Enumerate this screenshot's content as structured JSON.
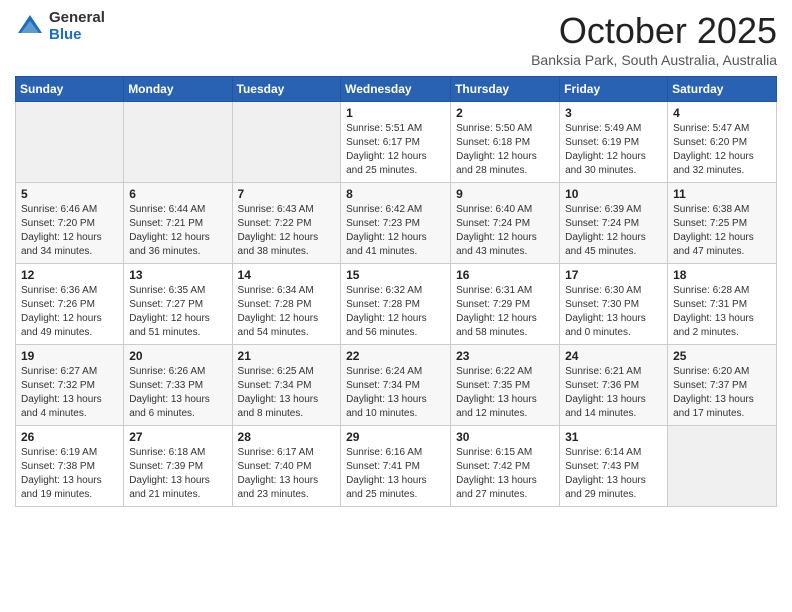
{
  "logo": {
    "general": "General",
    "blue": "Blue"
  },
  "header": {
    "month": "October 2025",
    "location": "Banksia Park, South Australia, Australia"
  },
  "days_of_week": [
    "Sunday",
    "Monday",
    "Tuesday",
    "Wednesday",
    "Thursday",
    "Friday",
    "Saturday"
  ],
  "weeks": [
    [
      {
        "day": "",
        "info": ""
      },
      {
        "day": "",
        "info": ""
      },
      {
        "day": "",
        "info": ""
      },
      {
        "day": "1",
        "info": "Sunrise: 5:51 AM\nSunset: 6:17 PM\nDaylight: 12 hours\nand 25 minutes."
      },
      {
        "day": "2",
        "info": "Sunrise: 5:50 AM\nSunset: 6:18 PM\nDaylight: 12 hours\nand 28 minutes."
      },
      {
        "day": "3",
        "info": "Sunrise: 5:49 AM\nSunset: 6:19 PM\nDaylight: 12 hours\nand 30 minutes."
      },
      {
        "day": "4",
        "info": "Sunrise: 5:47 AM\nSunset: 6:20 PM\nDaylight: 12 hours\nand 32 minutes."
      }
    ],
    [
      {
        "day": "5",
        "info": "Sunrise: 6:46 AM\nSunset: 7:20 PM\nDaylight: 12 hours\nand 34 minutes."
      },
      {
        "day": "6",
        "info": "Sunrise: 6:44 AM\nSunset: 7:21 PM\nDaylight: 12 hours\nand 36 minutes."
      },
      {
        "day": "7",
        "info": "Sunrise: 6:43 AM\nSunset: 7:22 PM\nDaylight: 12 hours\nand 38 minutes."
      },
      {
        "day": "8",
        "info": "Sunrise: 6:42 AM\nSunset: 7:23 PM\nDaylight: 12 hours\nand 41 minutes."
      },
      {
        "day": "9",
        "info": "Sunrise: 6:40 AM\nSunset: 7:24 PM\nDaylight: 12 hours\nand 43 minutes."
      },
      {
        "day": "10",
        "info": "Sunrise: 6:39 AM\nSunset: 7:24 PM\nDaylight: 12 hours\nand 45 minutes."
      },
      {
        "day": "11",
        "info": "Sunrise: 6:38 AM\nSunset: 7:25 PM\nDaylight: 12 hours\nand 47 minutes."
      }
    ],
    [
      {
        "day": "12",
        "info": "Sunrise: 6:36 AM\nSunset: 7:26 PM\nDaylight: 12 hours\nand 49 minutes."
      },
      {
        "day": "13",
        "info": "Sunrise: 6:35 AM\nSunset: 7:27 PM\nDaylight: 12 hours\nand 51 minutes."
      },
      {
        "day": "14",
        "info": "Sunrise: 6:34 AM\nSunset: 7:28 PM\nDaylight: 12 hours\nand 54 minutes."
      },
      {
        "day": "15",
        "info": "Sunrise: 6:32 AM\nSunset: 7:28 PM\nDaylight: 12 hours\nand 56 minutes."
      },
      {
        "day": "16",
        "info": "Sunrise: 6:31 AM\nSunset: 7:29 PM\nDaylight: 12 hours\nand 58 minutes."
      },
      {
        "day": "17",
        "info": "Sunrise: 6:30 AM\nSunset: 7:30 PM\nDaylight: 13 hours\nand 0 minutes."
      },
      {
        "day": "18",
        "info": "Sunrise: 6:28 AM\nSunset: 7:31 PM\nDaylight: 13 hours\nand 2 minutes."
      }
    ],
    [
      {
        "day": "19",
        "info": "Sunrise: 6:27 AM\nSunset: 7:32 PM\nDaylight: 13 hours\nand 4 minutes."
      },
      {
        "day": "20",
        "info": "Sunrise: 6:26 AM\nSunset: 7:33 PM\nDaylight: 13 hours\nand 6 minutes."
      },
      {
        "day": "21",
        "info": "Sunrise: 6:25 AM\nSunset: 7:34 PM\nDaylight: 13 hours\nand 8 minutes."
      },
      {
        "day": "22",
        "info": "Sunrise: 6:24 AM\nSunset: 7:34 PM\nDaylight: 13 hours\nand 10 minutes."
      },
      {
        "day": "23",
        "info": "Sunrise: 6:22 AM\nSunset: 7:35 PM\nDaylight: 13 hours\nand 12 minutes."
      },
      {
        "day": "24",
        "info": "Sunrise: 6:21 AM\nSunset: 7:36 PM\nDaylight: 13 hours\nand 14 minutes."
      },
      {
        "day": "25",
        "info": "Sunrise: 6:20 AM\nSunset: 7:37 PM\nDaylight: 13 hours\nand 17 minutes."
      }
    ],
    [
      {
        "day": "26",
        "info": "Sunrise: 6:19 AM\nSunset: 7:38 PM\nDaylight: 13 hours\nand 19 minutes."
      },
      {
        "day": "27",
        "info": "Sunrise: 6:18 AM\nSunset: 7:39 PM\nDaylight: 13 hours\nand 21 minutes."
      },
      {
        "day": "28",
        "info": "Sunrise: 6:17 AM\nSunset: 7:40 PM\nDaylight: 13 hours\nand 23 minutes."
      },
      {
        "day": "29",
        "info": "Sunrise: 6:16 AM\nSunset: 7:41 PM\nDaylight: 13 hours\nand 25 minutes."
      },
      {
        "day": "30",
        "info": "Sunrise: 6:15 AM\nSunset: 7:42 PM\nDaylight: 13 hours\nand 27 minutes."
      },
      {
        "day": "31",
        "info": "Sunrise: 6:14 AM\nSunset: 7:43 PM\nDaylight: 13 hours\nand 29 minutes."
      },
      {
        "day": "",
        "info": ""
      }
    ]
  ]
}
